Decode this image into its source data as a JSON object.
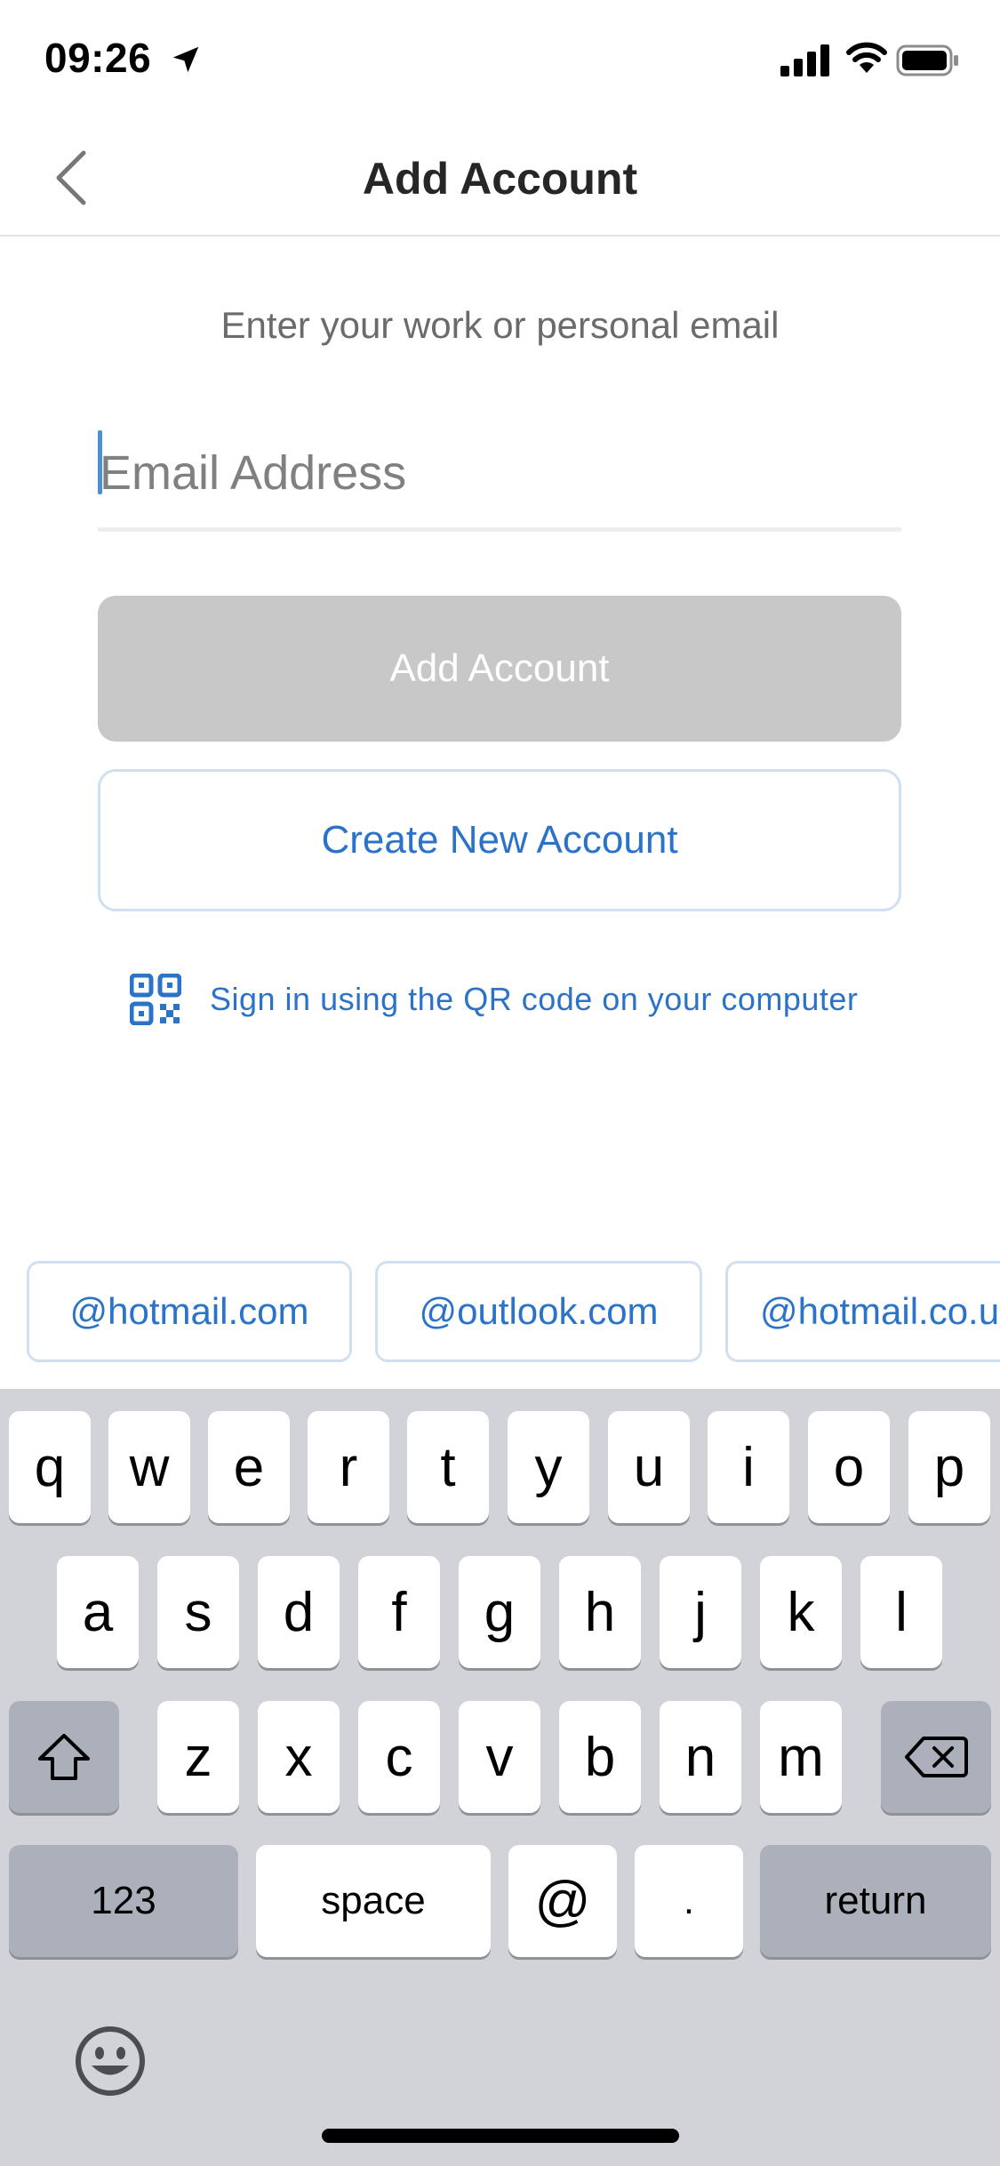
{
  "status_bar": {
    "time": "09:26",
    "icons": [
      "location-arrow-icon",
      "cell-signal-icon",
      "wifi-icon",
      "battery-icon"
    ]
  },
  "nav": {
    "back_icon": "chevron-left-icon",
    "title": "Add Account"
  },
  "form": {
    "prompt": "Enter your work or personal email",
    "email_placeholder": "Email Address",
    "email_value": "",
    "add_button_label": "Add Account",
    "create_button_label": "Create New Account",
    "qr_label": "Sign in using the QR code on your computer",
    "qr_icon": "qr-code-icon"
  },
  "suggestions": [
    "@hotmail.com",
    "@outlook.com",
    "@hotmail.co.u"
  ],
  "keyboard": {
    "row1": [
      "q",
      "w",
      "e",
      "r",
      "t",
      "y",
      "u",
      "i",
      "o",
      "p"
    ],
    "row2": [
      "a",
      "s",
      "d",
      "f",
      "g",
      "h",
      "j",
      "k",
      "l"
    ],
    "row3": [
      "z",
      "x",
      "c",
      "v",
      "b",
      "n",
      "m"
    ],
    "shift_icon": "shift-arrow-icon",
    "delete_icon": "delete-backspace-icon",
    "numbers_label": "123",
    "space_label": "space",
    "at_label": "@",
    "period_label": ".",
    "return_label": "return",
    "emoji_icon": "emoji-smiley-icon"
  },
  "colors": {
    "accent": "#2b73c9",
    "chip_border": "#cfe0f3",
    "disabled_button": "#c8c8c8",
    "keyboard_bg": "#d1d3d9",
    "dark_key": "#abb0bb"
  }
}
